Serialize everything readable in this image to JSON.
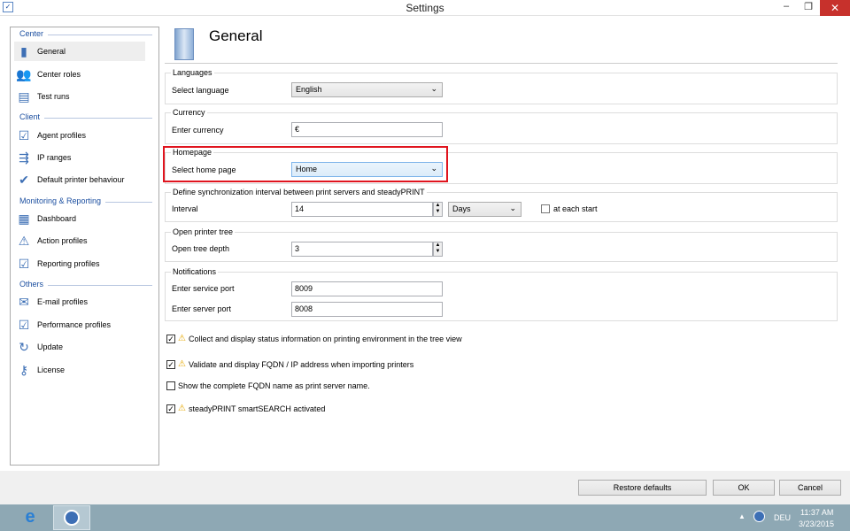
{
  "window": {
    "title": "Settings",
    "minimize": "–",
    "restore": "❐",
    "close": "✕"
  },
  "sidebar": {
    "sections": [
      {
        "label": "Center",
        "items": [
          {
            "label": "General",
            "icon": "server-icon"
          },
          {
            "label": "Center roles",
            "icon": "users-icon"
          },
          {
            "label": "Test runs",
            "icon": "monitor-icon"
          }
        ]
      },
      {
        "label": "Client",
        "items": [
          {
            "label": "Agent profiles",
            "icon": "agent-profile-icon"
          },
          {
            "label": "IP ranges",
            "icon": "network-icon"
          },
          {
            "label": "Default printer behaviour",
            "icon": "printer-check-icon"
          }
        ]
      },
      {
        "label": "Monitoring & Reporting",
        "items": [
          {
            "label": "Dashboard",
            "icon": "dashboard-icon"
          },
          {
            "label": "Action profiles",
            "icon": "action-profile-icon"
          },
          {
            "label": "Reporting profiles",
            "icon": "report-icon"
          }
        ]
      },
      {
        "label": "Others",
        "items": [
          {
            "label": "E-mail profiles",
            "icon": "email-icon"
          },
          {
            "label": "Performance profiles",
            "icon": "performance-icon"
          },
          {
            "label": "Update",
            "icon": "update-icon"
          },
          {
            "label": "License",
            "icon": "key-icon"
          }
        ]
      }
    ],
    "selected": "General"
  },
  "header": {
    "title": "General"
  },
  "languages": {
    "group": "Languages",
    "label": "Select language",
    "value": "English"
  },
  "currency": {
    "group": "Currency",
    "label": "Enter currency",
    "value": "€"
  },
  "homepage": {
    "group": "Homepage",
    "label": "Select home page",
    "value": "Home",
    "highlight_color": "#e0141e"
  },
  "sync": {
    "group": "Define synchronization interval between print servers and steadyPRINT",
    "label": "Interval",
    "value": "14",
    "unit": "Days",
    "at_each_start_label": "at each start",
    "at_each_start": false
  },
  "tree": {
    "group": "Open printer tree",
    "label": "Open tree depth",
    "value": "3"
  },
  "notifications": {
    "group": "Notifications",
    "service_label": "Enter service port",
    "service_value": "8009",
    "server_label": "Enter server port",
    "server_value": "8008"
  },
  "options": [
    {
      "label": "Collect and display status information on printing environment in the tree view",
      "checked": true,
      "warning": true
    },
    {
      "label": "Validate and display FQDN / IP address when importing printers",
      "checked": true,
      "warning": true
    },
    {
      "label": "Show the complete FQDN name as print server name.",
      "checked": false,
      "warning": false
    },
    {
      "label": "steadyPRINT smartSEARCH activated",
      "checked": true,
      "warning": true
    }
  ],
  "buttons": {
    "restore": "Restore defaults",
    "ok": "OK",
    "cancel": "Cancel"
  },
  "taskbar": {
    "language": "DEU",
    "time": "11:37 AM",
    "date": "3/23/2015"
  }
}
